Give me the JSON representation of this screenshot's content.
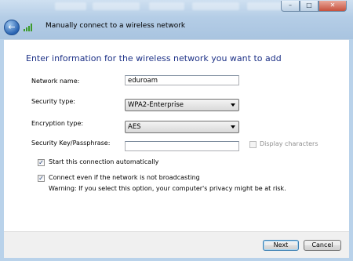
{
  "window": {
    "title": "Manually connect to a wireless network",
    "controls": {
      "minimize": "–",
      "maximize": "□",
      "close": "✕"
    }
  },
  "back_icon": "back-arrow-icon",
  "heading": "Enter information for the wireless network you want to add",
  "form": {
    "network_name": {
      "label": "Network name:",
      "value": "eduroam"
    },
    "security_type": {
      "label": "Security type:",
      "value": "WPA2-Enterprise"
    },
    "encryption_type": {
      "label": "Encryption type:",
      "value": "AES"
    },
    "security_key": {
      "label": "Security Key/Passphrase:",
      "value": ""
    },
    "display_characters": {
      "label": "Display characters",
      "checked": false,
      "enabled": false
    },
    "start_auto": {
      "label": "Start this connection automatically",
      "checked": true
    },
    "connect_not_broadcasting": {
      "label": "Connect even if the network is not broadcasting",
      "checked": true
    },
    "warning": "Warning: If you select this option, your computer's privacy might be at risk."
  },
  "buttons": {
    "next": "Next",
    "cancel": "Cancel"
  },
  "colors": {
    "heading": "#1e3287",
    "titlebar": "#b4cde6"
  }
}
